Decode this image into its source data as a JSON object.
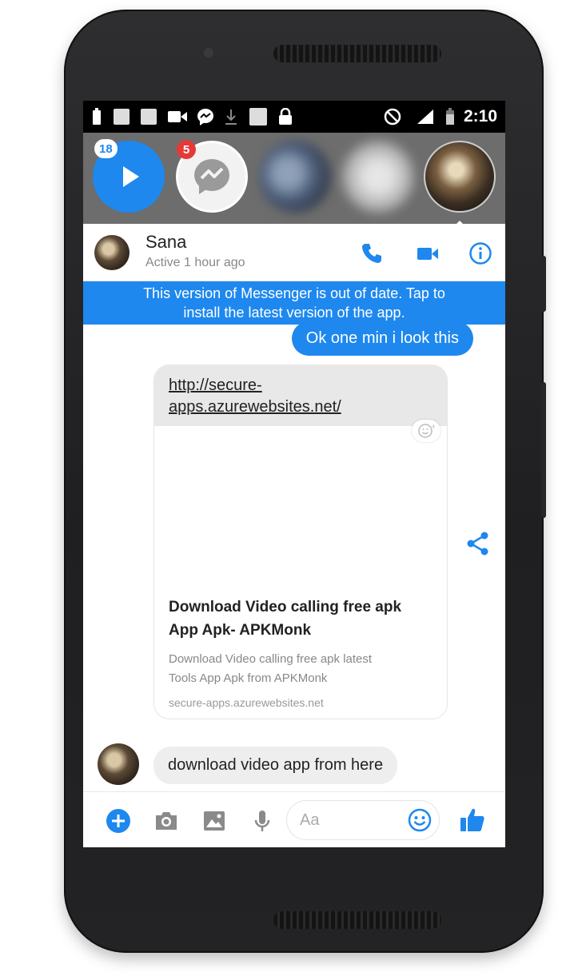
{
  "statusbar": {
    "time": "2:10"
  },
  "chatheads": {
    "video_badge": "18",
    "messenger_badge": "5"
  },
  "contact": {
    "name": "Sana",
    "status": "Active 1 hour ago"
  },
  "banner": {
    "line1": "This version of Messenger is out of date. Tap to",
    "line2": "install the latest version of the app."
  },
  "messages": {
    "outgoing": "Ok one min i look this",
    "incoming": "download video app from here"
  },
  "link_card": {
    "url_line1": "http://secure-",
    "url_line2": "apps.azurewebsites.net/",
    "title_line1": "Download Video calling free apk",
    "title_line2": "App Apk- APKMonk",
    "desc_line1": "Download Video calling free apk latest",
    "desc_line2": "Tools App Apk from APKMonk",
    "domain": "secure-apps.azurewebsites.net"
  },
  "composer": {
    "placeholder": "Aa"
  },
  "colors": {
    "accent": "#1e88ee",
    "badge_red": "#e53935",
    "phone_body": "#232325"
  }
}
